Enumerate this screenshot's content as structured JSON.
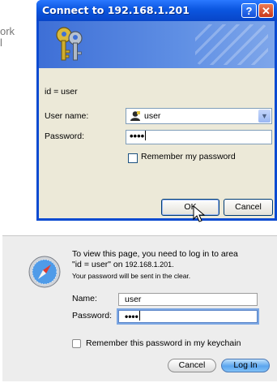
{
  "background": {
    "fragment_lines": [
      "ork",
      "l"
    ]
  },
  "xp_dialog": {
    "title": "Connect to 192.168.1.201",
    "help_glyph": "?",
    "close_glyph": "✕",
    "realm_text": "id = user",
    "username_label": "User name:",
    "username_value": "user",
    "password_label": "Password:",
    "password_value": "••••",
    "remember_label": "Remember my password",
    "remember_checked": false,
    "ok_label": "OK",
    "cancel_label": "Cancel",
    "icons": [
      "keys-icon",
      "user-icon",
      "dropdown-arrow-icon",
      "pointer-cursor-icon"
    ],
    "colors": {
      "titlebar": "#0b56e0",
      "body": "#ece9d8",
      "close": "#c7381a"
    }
  },
  "mac_dialog": {
    "message_line1": "To view this page, you need to log in to area",
    "message_line2_prefix": "\"id = user\" on ",
    "message_line2_host": "192.168.1.201.",
    "note": "Your password will be sent in the clear.",
    "name_label": "Name:",
    "name_value": "user",
    "password_label": "Password:",
    "password_value": "••••",
    "keychain_label": "Remember this password in my keychain",
    "keychain_checked": false,
    "cancel_label": "Cancel",
    "login_label": "Log In",
    "icons": [
      "safari-compass-icon"
    ],
    "colors": {
      "default_button": "#5aa5ef",
      "focus_ring": "#7ca7e3"
    }
  }
}
